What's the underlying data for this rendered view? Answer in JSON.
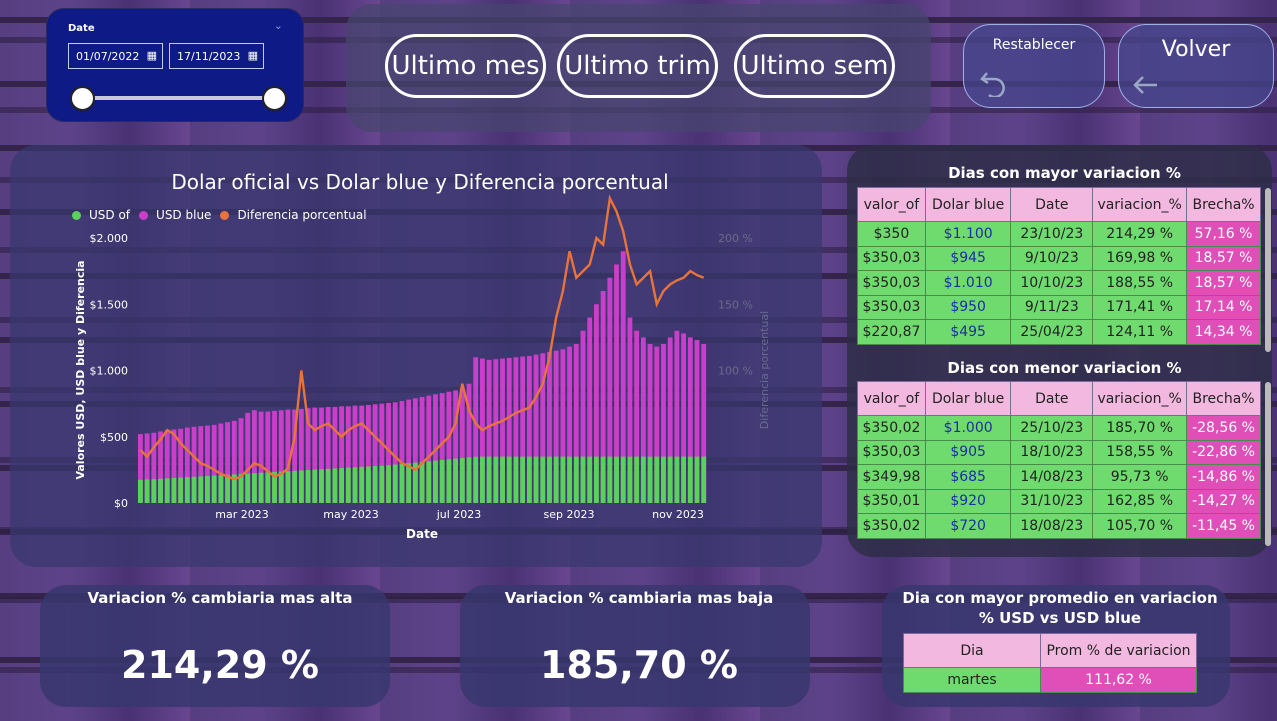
{
  "slicer": {
    "label": "Date",
    "start": "01/07/2022",
    "end": "17/11/2023"
  },
  "period_buttons": [
    "Ultimo mes",
    "Ultimo trim",
    "Ultimo sem"
  ],
  "nav": {
    "reset": "Restablecer",
    "back": "Volver"
  },
  "chart_data": {
    "type": "bar",
    "title": "Dolar oficial vs Dolar blue y Diferencia porcentual",
    "legend": [
      "USD of",
      "USD blue",
      "Diferencia porcentual"
    ],
    "colors": {
      "usd_of": "#5ad15a",
      "usd_blue": "#c93fc9",
      "diff": "#e8743b"
    },
    "ylabel": "Valores USD, USD blue y Diferencia",
    "y2label": "Diferencia porcentual",
    "xlabel": "Date",
    "y_ticks": [
      "$2.000",
      "$1.500",
      "$1.000",
      "$500",
      "$0"
    ],
    "y2_ticks": [
      "200 %",
      "150 %",
      "100 %"
    ],
    "x_ticks": [
      "mar 2023",
      "may 2023",
      "jul 2023",
      "sep 2023",
      "nov 2023"
    ],
    "ylim": [
      0,
      2000
    ],
    "y2lim": [
      0,
      200
    ],
    "series": [
      {
        "name": "USD of",
        "values": [
          175,
          178,
          180,
          183,
          186,
          189,
          192,
          195,
          198,
          201,
          204,
          207,
          210,
          213,
          216,
          219,
          222,
          225,
          228,
          231,
          234,
          237,
          240,
          243,
          246,
          249,
          252,
          255,
          258,
          261,
          264,
          267,
          270,
          273,
          276,
          279,
          282,
          285,
          290,
          295,
          300,
          305,
          310,
          315,
          320,
          325,
          330,
          335,
          340,
          345,
          349,
          350,
          350,
          350,
          350,
          350,
          350,
          350,
          350,
          350,
          350,
          350,
          350,
          350,
          350,
          350,
          350,
          350,
          350,
          350,
          350,
          350,
          350,
          350,
          350,
          350,
          350,
          350,
          350,
          350,
          350,
          350,
          350,
          350,
          350
        ]
      },
      {
        "name": "USD blue",
        "values": [
          520,
          525,
          530,
          540,
          550,
          555,
          560,
          570,
          575,
          580,
          585,
          590,
          600,
          610,
          620,
          640,
          680,
          700,
          690,
          690,
          695,
          700,
          705,
          705,
          710,
          715,
          720,
          720,
          725,
          725,
          730,
          730,
          735,
          735,
          740,
          745,
          750,
          755,
          760,
          770,
          780,
          790,
          800,
          810,
          820,
          830,
          840,
          850,
          870,
          900,
          1100,
          1090,
          1080,
          1085,
          1090,
          1095,
          1100,
          1105,
          1110,
          1120,
          1130,
          1140,
          1150,
          1160,
          1180,
          1200,
          1300,
          1400,
          1500,
          1600,
          1700,
          1800,
          1900,
          1400,
          1300,
          1250,
          1200,
          1180,
          1200,
          1250,
          1300,
          1280,
          1250,
          1230,
          1200
        ]
      },
      {
        "name": "Diferencia porcentual",
        "values": [
          40,
          35,
          42,
          48,
          55,
          52,
          45,
          40,
          35,
          30,
          28,
          25,
          22,
          20,
          18,
          20,
          25,
          30,
          28,
          24,
          20,
          22,
          26,
          50,
          100,
          60,
          55,
          58,
          60,
          55,
          50,
          55,
          58,
          60,
          55,
          50,
          45,
          40,
          35,
          30,
          28,
          25,
          30,
          35,
          40,
          45,
          50,
          60,
          90,
          70,
          60,
          55,
          58,
          60,
          62,
          65,
          68,
          70,
          72,
          80,
          90,
          110,
          140,
          160,
          190,
          170,
          175,
          180,
          200,
          195,
          230,
          220,
          205,
          180,
          165,
          170,
          175,
          150,
          160,
          165,
          168,
          170,
          175,
          172,
          170
        ]
      }
    ]
  },
  "table_high": {
    "title": "Dias con mayor variacion %",
    "headers": [
      "valor_of",
      "Dolar blue",
      "Date",
      "variacion_%",
      "Brecha%"
    ],
    "rows": [
      [
        "$350",
        "$1.100",
        "23/10/23",
        "214,29 %",
        "57,16 %"
      ],
      [
        "$350,03",
        "$945",
        "9/10/23",
        "169,98 %",
        "18,57 %"
      ],
      [
        "$350,03",
        "$1.010",
        "10/10/23",
        "188,55 %",
        "18,57 %"
      ],
      [
        "$350,03",
        "$950",
        "9/11/23",
        "171,41 %",
        "17,14 %"
      ],
      [
        "$220,87",
        "$495",
        "25/04/23",
        "124,11 %",
        "14,34 %"
      ]
    ]
  },
  "table_low": {
    "title": "Dias con menor variacion %",
    "headers": [
      "valor_of",
      "Dolar blue",
      "Date",
      "variacion_%",
      "Brecha%"
    ],
    "rows": [
      [
        "$350,02",
        "$1.000",
        "25/10/23",
        "185,70 %",
        "-28,56 %"
      ],
      [
        "$350,03",
        "$905",
        "18/10/23",
        "158,55 %",
        "-22,86 %"
      ],
      [
        "$349,98",
        "$685",
        "14/08/23",
        "95,73 %",
        "-14,86 %"
      ],
      [
        "$350,01",
        "$920",
        "31/10/23",
        "162,85 %",
        "-14,27 %"
      ],
      [
        "$350,02",
        "$720",
        "18/08/23",
        "105,70 %",
        "-11,45 %"
      ]
    ]
  },
  "kpi_high": {
    "title": "Variacion % cambiaria mas alta",
    "value": "214,29 %"
  },
  "kpi_low": {
    "title": "Variacion % cambiaria mas baja",
    "value": "185,70 %"
  },
  "best_day": {
    "title_line1": "Dia con mayor promedio en variacion",
    "title_line2": "% USD vs USD blue",
    "headers": [
      "Dia",
      "Prom % de variacion"
    ],
    "row": [
      "martes",
      "111,62 %"
    ]
  }
}
